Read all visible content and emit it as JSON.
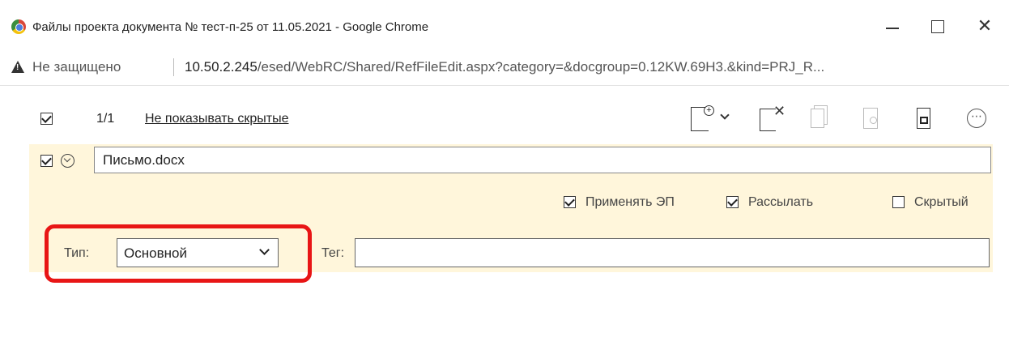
{
  "window": {
    "title": "Файлы проекта документа № тест-п-25 от 11.05.2021 - Google Chrome",
    "controls": {
      "minimize": "—",
      "maximize": "☐",
      "close": "✕"
    }
  },
  "address": {
    "security_label": "Не защищено",
    "url_host": "10.50.2.245",
    "url_path": "/esed/WebRC/Shared/RefFileEdit.aspx?category=&docgroup=0.12KW.69H3.&kind=PRJ_R..."
  },
  "toolbar": {
    "counter": "1/1",
    "hidden_link": "Не показывать скрытые",
    "more_glyph": "⋯"
  },
  "file": {
    "name": "Письмо.docx",
    "apply_signature_label": "Применять ЭП",
    "apply_signature_checked": true,
    "send_label": "Рассылать",
    "send_checked": true,
    "hidden_label": "Скрытый",
    "hidden_checked": false,
    "type_label": "Тип:",
    "type_value": "Основной",
    "tag_label": "Тег:",
    "tag_value": ""
  },
  "colors": {
    "panel_background": "#fff6db",
    "highlight": "#e81515"
  }
}
